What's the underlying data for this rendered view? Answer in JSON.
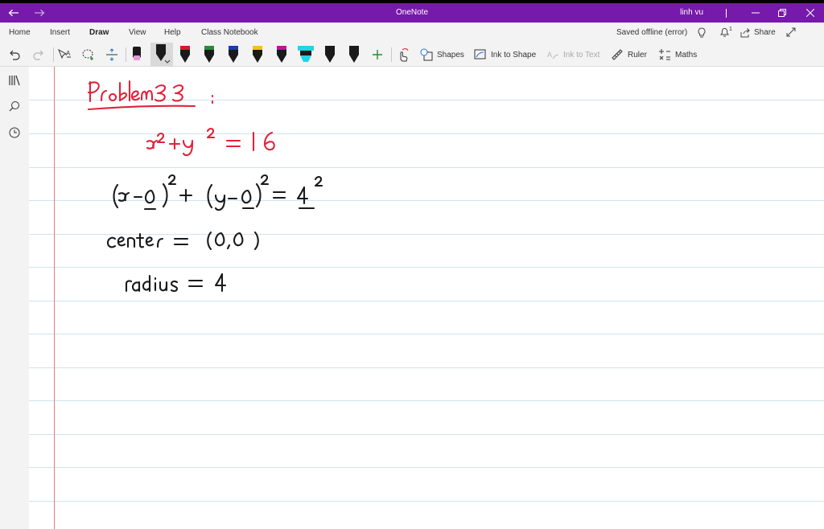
{
  "window": {
    "app_title": "OneNote",
    "user_name": "linh vu"
  },
  "menu": {
    "tabs": [
      {
        "label": "Home"
      },
      {
        "label": "Insert"
      },
      {
        "label": "Draw"
      },
      {
        "label": "View"
      },
      {
        "label": "Help"
      },
      {
        "label": "Class Notebook"
      }
    ],
    "active_tab": "Draw",
    "status": "Saved offline (error)",
    "notifications_count": "1",
    "share_label": "Share"
  },
  "toolbar": {
    "shapes_label": "Shapes",
    "ink_to_shape_label": "Ink to Shape",
    "ink_to_text_label": "Ink to Text",
    "ruler_label": "Ruler",
    "maths_label": "Maths",
    "pens": [
      {
        "icon": "pencil-pink-icon",
        "color": "#e59ad6"
      },
      {
        "icon": "pen-black-selected-icon",
        "color": "#222222"
      },
      {
        "icon": "pen-red-icon",
        "color": "#d8192b"
      },
      {
        "icon": "pen-green-icon",
        "color": "#2a8a3a"
      },
      {
        "icon": "pen-blue-icon",
        "color": "#1f3da8"
      },
      {
        "icon": "pen-yellow-icon",
        "color": "#f3c117"
      },
      {
        "icon": "pen-magenta-icon",
        "color": "#c2129b"
      },
      {
        "icon": "highlighter-cyan-icon",
        "color": "#21d4e8"
      },
      {
        "icon": "pen-black-icon",
        "color": "#222222"
      },
      {
        "icon": "pen-black-2-icon",
        "color": "#222222"
      }
    ]
  },
  "colors": {
    "accent": "#7719aa",
    "ink_red": "#e0233a",
    "ink_black": "#1a1a1a",
    "rule_line": "#cfe3f0",
    "margin_line": "#e57b7b"
  },
  "page": {
    "handwriting": {
      "title": "Problem 33 :",
      "line1": "x² + y² = 16",
      "line2": "(x − 0)² + (y − 0)² = 4²",
      "line3": "center = (0,0)",
      "line4": "radius = 4"
    }
  }
}
